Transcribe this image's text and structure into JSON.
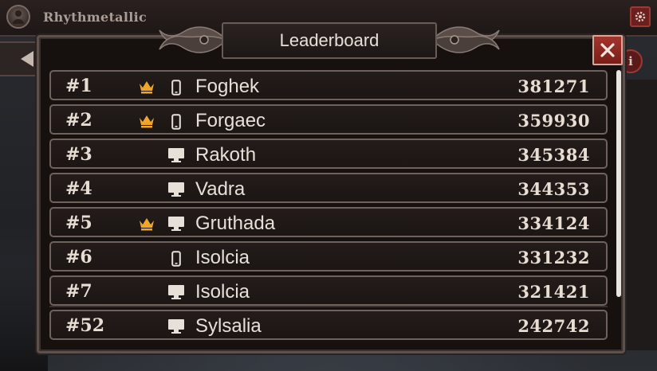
{
  "app": {
    "title": "Rhythmetallic"
  },
  "panel": {
    "title": "Leaderboard"
  },
  "colors": {
    "crown": "#f0a62a",
    "panel_border": "#6f625d",
    "close_bg": "#8f2a22",
    "text": "#e7e0d9"
  },
  "leaderboard": [
    {
      "rank": "#1",
      "crown": true,
      "device": "phone-icon",
      "name": "Foghek",
      "score": "381271"
    },
    {
      "rank": "#2",
      "crown": true,
      "device": "phone-icon",
      "name": "Forgaec",
      "score": "359930"
    },
    {
      "rank": "#3",
      "crown": false,
      "device": "desktop-icon",
      "name": "Rakoth",
      "score": "345384"
    },
    {
      "rank": "#4",
      "crown": false,
      "device": "desktop-icon",
      "name": "Vadra",
      "score": "344353"
    },
    {
      "rank": "#5",
      "crown": true,
      "device": "desktop-icon",
      "name": "Gruthada",
      "score": "334124"
    },
    {
      "rank": "#6",
      "crown": false,
      "device": "phone-icon",
      "name": "Isolcia",
      "score": "331232"
    },
    {
      "rank": "#7",
      "crown": false,
      "device": "desktop-icon",
      "name": "Isolcia",
      "score": "321421"
    }
  ],
  "player_row": {
    "rank": "#52",
    "crown": false,
    "device": "desktop-icon",
    "name": "Sylsalia",
    "score": "242742"
  }
}
